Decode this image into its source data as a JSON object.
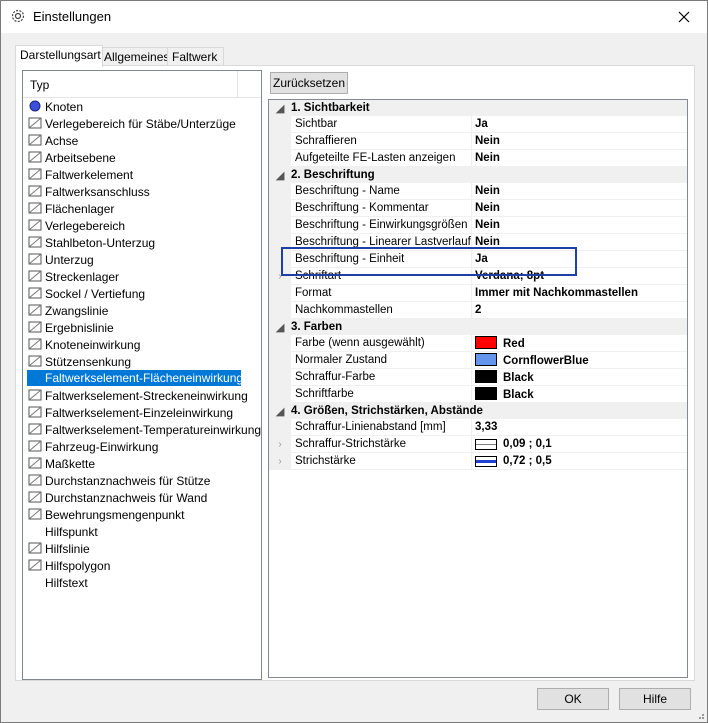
{
  "window": {
    "title": "Einstellungen"
  },
  "tabs": [
    {
      "label": "Darstellungsart"
    },
    {
      "label": "Allgemeines"
    },
    {
      "label": "Faltwerk"
    }
  ],
  "left": {
    "header": "Typ",
    "items": [
      {
        "label": "Knoten",
        "icon": "knot-icon"
      },
      {
        "label": "Verlegebereich für Stäbe/Unterzüge",
        "icon": "area-icon"
      },
      {
        "label": "Achse",
        "icon": "axis-icon"
      },
      {
        "label": "Arbeitsebene",
        "icon": "plane-icon"
      },
      {
        "label": "Faltwerkelement",
        "icon": "element-icon"
      },
      {
        "label": "Faltwerksanschluss",
        "icon": "connection-icon"
      },
      {
        "label": "Flächenlager",
        "icon": "support-icon"
      },
      {
        "label": "Verlegebereich",
        "icon": "grid-icon"
      },
      {
        "label": "Stahlbeton-Unterzug",
        "icon": "beam-icon"
      },
      {
        "label": "Unterzug",
        "icon": "ibeam-icon"
      },
      {
        "label": "Streckenlager",
        "icon": "line-support-icon"
      },
      {
        "label": "Sockel / Vertiefung",
        "icon": "socket-icon"
      },
      {
        "label": "Zwangslinie",
        "icon": "constraint-icon"
      },
      {
        "label": "Ergebnislinie",
        "icon": "result-line-icon"
      },
      {
        "label": "Knoteneinwirkung",
        "icon": "node-load-icon"
      },
      {
        "label": "Stützensenkung",
        "icon": "settlement-icon"
      },
      {
        "label": "Faltwerkselement-Flächeneinwirkung",
        "icon": "area-load-icon"
      },
      {
        "label": "Faltwerkselement-Streckeneinwirkung",
        "icon": "line-load-icon"
      },
      {
        "label": "Faltwerkselement-Einzeleinwirkung",
        "icon": "point-load-icon"
      },
      {
        "label": "Faltwerkselement-Temperatureinwirkung",
        "icon": "temperature-icon"
      },
      {
        "label": "Fahrzeug-Einwirkung",
        "icon": "vehicle-icon"
      },
      {
        "label": "Maßkette",
        "icon": "dimension-icon"
      },
      {
        "label": "Durchstanznachweis für Stütze",
        "icon": "punching-column-icon"
      },
      {
        "label": "Durchstanznachweis für Wand",
        "icon": "punching-wall-icon"
      },
      {
        "label": "Bewehrungsmengenpunkt",
        "icon": "reinforcement-icon"
      },
      {
        "label": "Hilfspunkt",
        "icon": ""
      },
      {
        "label": "Hilfslinie",
        "icon": "helper-line-icon"
      },
      {
        "label": "Hilfspolygon",
        "icon": "helper-polygon-icon"
      },
      {
        "label": "Hilfstext",
        "icon": ""
      }
    ],
    "selected_index": 16
  },
  "right": {
    "reset_label": "Zurücksetzen",
    "groups": [
      {
        "title": "1. Sichtbarkeit",
        "rows": [
          {
            "name": "Sichtbar",
            "value": "Ja"
          },
          {
            "name": "Schraffieren",
            "value": "Nein"
          },
          {
            "name": "Aufgeteilte FE-Lasten anzeigen",
            "value": "Nein"
          }
        ]
      },
      {
        "title": "2. Beschriftung",
        "rows": [
          {
            "name": "Beschriftung - Name",
            "value": "Nein"
          },
          {
            "name": "Beschriftung - Kommentar",
            "value": "Nein"
          },
          {
            "name": "Beschriftung - Einwirkungsgrößen",
            "value": "Nein"
          },
          {
            "name": "Beschriftung - Linearer Lastverlauf",
            "value": "Nein"
          },
          {
            "name": "Beschriftung - Einheit",
            "value": "Ja"
          },
          {
            "name": "Schriftart",
            "value": "Verdana; 8pt",
            "expandable": true
          },
          {
            "name": "Format",
            "value": "Immer mit Nachkommastellen"
          },
          {
            "name": "Nachkommastellen",
            "value": "2"
          }
        ]
      },
      {
        "title": "3. Farben",
        "rows": [
          {
            "name": "Farbe (wenn ausgewählt)",
            "value": "Red",
            "swatch": "#ff0000"
          },
          {
            "name": "Normaler Zustand",
            "value": "CornflowerBlue",
            "swatch": "#6495ed"
          },
          {
            "name": "Schraffur-Farbe",
            "value": "Black",
            "swatch": "#000000"
          },
          {
            "name": "Schriftfarbe",
            "value": "Black",
            "swatch": "#000000"
          }
        ]
      },
      {
        "title": "4. Größen, Strichstärken, Abstände",
        "rows": [
          {
            "name": "Schraffur-Linienabstand [mm]",
            "value": "3,33"
          },
          {
            "name": "Schraffur-Strichstärke",
            "value": "0,09 ; 0,1",
            "expandable": true,
            "linestyle": "thin"
          },
          {
            "name": "Strichstärke",
            "value": "0,72 ; 0,5",
            "expandable": true,
            "linestyle": "blue"
          }
        ]
      }
    ]
  },
  "footer": {
    "ok_label": "OK",
    "help_label": "Hilfe"
  },
  "colors": {
    "selection": "#0078d7",
    "highlight_border": "#1f3fa8"
  }
}
